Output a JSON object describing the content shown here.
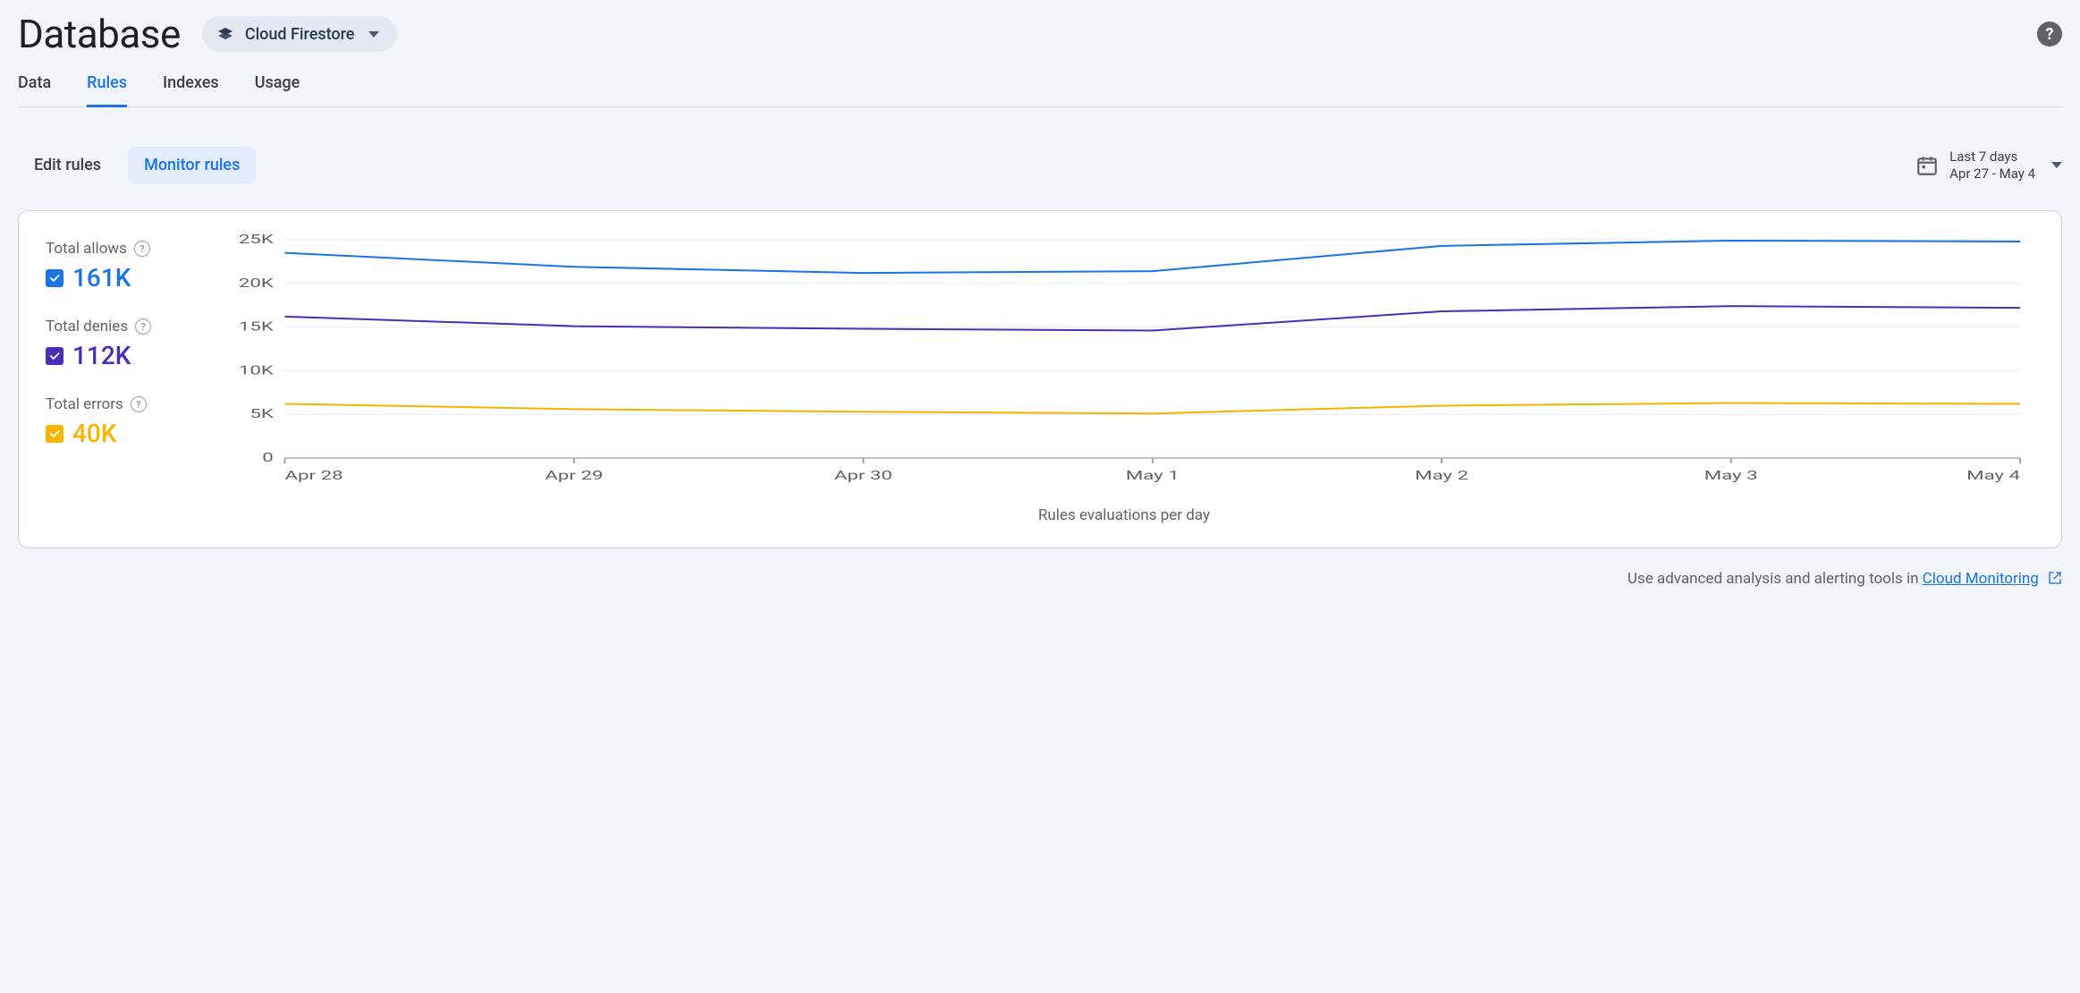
{
  "header": {
    "title": "Database",
    "selector_label": "Cloud Firestore"
  },
  "tabs": [
    {
      "label": "Data",
      "active": false
    },
    {
      "label": "Rules",
      "active": true
    },
    {
      "label": "Indexes",
      "active": false
    },
    {
      "label": "Usage",
      "active": false
    }
  ],
  "subtabs": {
    "edit": "Edit rules",
    "monitor": "Monitor rules"
  },
  "date_range": {
    "top": "Last 7 days",
    "bottom": "Apr 27 - May 4"
  },
  "legend": {
    "allows": {
      "label": "Total allows",
      "value": "161K",
      "color": "#1a73e8"
    },
    "denies": {
      "label": "Total denies",
      "value": "112K",
      "color": "#4d2db7"
    },
    "errors": {
      "label": "Total errors",
      "value": "40K",
      "color": "#f4b400"
    }
  },
  "footer": {
    "prefix": "Use advanced analysis and alerting tools in ",
    "link_label": "Cloud Monitoring"
  },
  "chart_data": {
    "type": "line",
    "title": "",
    "xlabel": "Rules evaluations per day",
    "ylabel": "",
    "ylim": [
      0,
      25000
    ],
    "y_ticks": [
      "0",
      "5K",
      "10K",
      "15K",
      "20K",
      "25K"
    ],
    "categories": [
      "Apr 28",
      "Apr 29",
      "Apr 30",
      "May 1",
      "May 2",
      "May 3",
      "May 4"
    ],
    "series": [
      {
        "name": "Total allows",
        "color": "#1a73e8",
        "values": [
          23500,
          21900,
          21200,
          21400,
          24300,
          24900,
          24800
        ]
      },
      {
        "name": "Total denies",
        "color": "#4d2db7",
        "values": [
          16200,
          15100,
          14800,
          14600,
          16800,
          17400,
          17200
        ]
      },
      {
        "name": "Total errors",
        "color": "#f4b400",
        "values": [
          6200,
          5600,
          5300,
          5100,
          6000,
          6300,
          6200
        ]
      }
    ]
  }
}
